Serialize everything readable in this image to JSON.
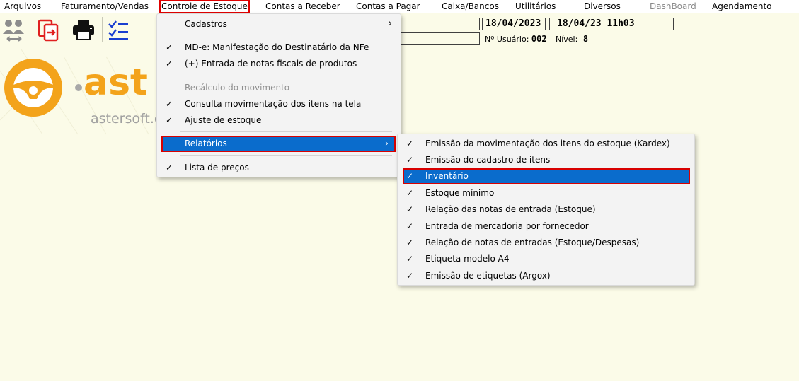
{
  "menubar": {
    "items": [
      {
        "label": "Arquivos"
      },
      {
        "label": "Faturamento/Vendas"
      },
      {
        "label": "Controle de Estoque"
      },
      {
        "label": "Contas a Receber"
      },
      {
        "label": "Contas a Pagar"
      },
      {
        "label": "Caixa/Bancos"
      },
      {
        "label": "Utilitários"
      },
      {
        "label": "Diversos"
      },
      {
        "label": "DashBoard"
      },
      {
        "label": "Agendamento"
      }
    ]
  },
  "toolbar": {
    "icons": [
      "users-icon",
      "exit-app-icon",
      "printer-icon",
      "checklist-icon"
    ]
  },
  "logo": {
    "brand": "ast",
    "site": "astersoft.c"
  },
  "info": {
    "date": "18/04/2023",
    "datetime": "18/04/23 11h03",
    "user_label": "Nº Usuário:",
    "user_value": "002",
    "level_label": "Nível:",
    "level_value": "8"
  },
  "menu": {
    "items": [
      {
        "label": "Cadastros",
        "check": false,
        "submenu": true
      },
      {
        "label": "MD-e: Manifestação do Destinatário da NFe",
        "check": true
      },
      {
        "label": "(+) Entrada de notas fiscais de produtos",
        "check": true
      },
      {
        "label": "Recálculo do movimento",
        "check": false,
        "disabled": true
      },
      {
        "label": "Consulta movimentação dos itens na tela",
        "check": true
      },
      {
        "label": "Ajuste de estoque",
        "check": true
      },
      {
        "label": "Relatórios",
        "check": false,
        "submenu": true,
        "selected": true
      },
      {
        "label": "Lista de preços",
        "check": true
      }
    ]
  },
  "submenu": {
    "items": [
      {
        "label": "Emissão da movimentação dos itens do estoque (Kardex)",
        "check": true
      },
      {
        "label": "Emissão do cadastro de itens",
        "check": true
      },
      {
        "label": "Inventário",
        "check": true,
        "selected": true
      },
      {
        "label": "Estoque mínimo",
        "check": true
      },
      {
        "label": "Relação das notas de entrada (Estoque)",
        "check": true
      },
      {
        "label": "Entrada de mercadoria por fornecedor",
        "check": true
      },
      {
        "label": "Relação de notas de entradas (Estoque/Despesas)",
        "check": true
      },
      {
        "label": "Etiqueta modelo A4",
        "check": true
      },
      {
        "label": "Emissão de etiquetas (Argox)",
        "check": true
      }
    ]
  },
  "glyphs": {
    "check": "✓",
    "arrow": "›"
  },
  "colors": {
    "background": "#fbfbe8",
    "selection": "#0a6ccc",
    "highlight_box": "#e00000",
    "logo_orange": "#f3a31b"
  }
}
